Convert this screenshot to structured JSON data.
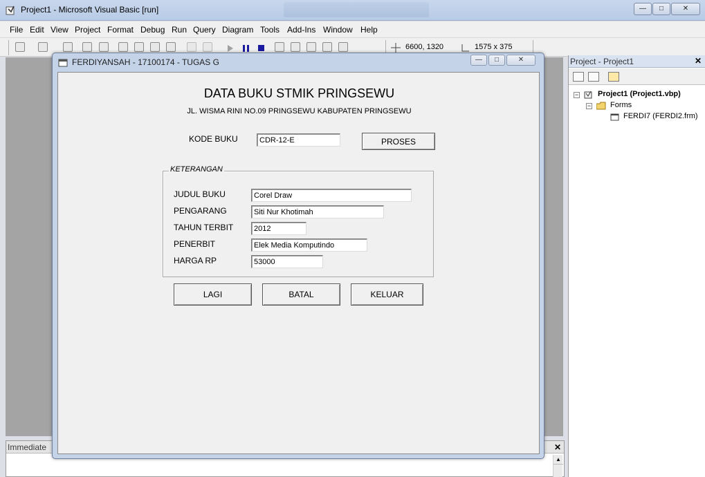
{
  "window": {
    "title": "Project1 - Microsoft Visual Basic [run]",
    "minimize": "—",
    "maximize": "□",
    "close": "✕"
  },
  "menu": [
    "File",
    "Edit",
    "View",
    "Project",
    "Format",
    "Debug",
    "Run",
    "Query",
    "Diagram",
    "Tools",
    "Add-Ins",
    "Window",
    "Help"
  ],
  "toolbar": {
    "position": "6600, 1320",
    "size": "1575 x 375"
  },
  "immediate": {
    "title": "Immediate",
    "close": "✕",
    "scroll_up": "▲"
  },
  "project": {
    "title": "Project - Project1",
    "close": "✕",
    "root": "Project1 (Project1.vbp)",
    "folder": "Forms",
    "form_file": "FERDI7 (FERDI2.frm)",
    "expand_root": "−",
    "expand_folder": "−"
  },
  "form": {
    "title": "FERDIYANSAH - 17100174 - TUGAS G",
    "minimize": "—",
    "maximize": "□",
    "close": "✕",
    "heading": "DATA BUKU STMIK PRINGSEWU",
    "address": "JL. WISMA RINI NO.09 PRINGSEWU KABUPATEN PRINGSEWU",
    "kode_label": "KODE BUKU",
    "kode_value": "CDR-12-E",
    "proses": "PROSES",
    "frame_caption": "KETERANGAN",
    "fields": [
      {
        "label": "JUDUL BUKU",
        "value": "Corel Draw"
      },
      {
        "label": "PENGARANG",
        "value": "Siti Nur Khotimah"
      },
      {
        "label": "TAHUN TERBIT",
        "value": "2012"
      },
      {
        "label": "PENERBIT",
        "value": "Elek Media Komputindo"
      },
      {
        "label": "HARGA RP",
        "value": "53000"
      }
    ],
    "buttons": {
      "lagi": "LAGI",
      "batal": "BATAL",
      "keluar": "KELUAR"
    }
  }
}
